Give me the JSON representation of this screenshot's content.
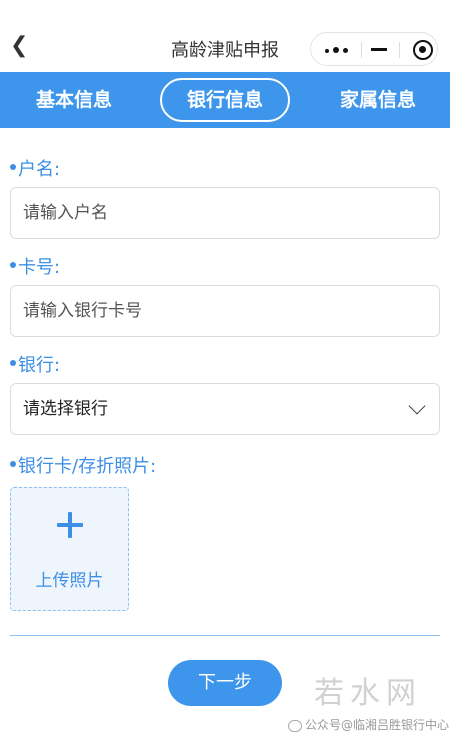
{
  "header": {
    "title": "高龄津贴申报",
    "back_icon": "chevron-left-icon",
    "capsule": {
      "more_icon": "more-dots-icon",
      "minimize_icon": "minimize-icon",
      "close_icon": "target-close-icon"
    }
  },
  "tabs": [
    {
      "label": "基本信息",
      "active": false
    },
    {
      "label": "银行信息",
      "active": true
    },
    {
      "label": "家属信息",
      "active": false
    }
  ],
  "form": {
    "account_name": {
      "label": "户名:",
      "placeholder": "请输入户名"
    },
    "card_number": {
      "label": "卡号:",
      "placeholder": "请输入银行卡号"
    },
    "bank": {
      "label": "银行:",
      "value": "请选择银行"
    },
    "photo": {
      "label": "银行卡/存折照片:",
      "upload_label": "上传照片"
    }
  },
  "next_button": "下一步",
  "watermark": "若水网",
  "source": "公众号@临湘吕胜银行中心",
  "colors": {
    "accent": "#3d95ec",
    "label": "#3d8fe6",
    "upload_bg": "#eef5fd"
  }
}
